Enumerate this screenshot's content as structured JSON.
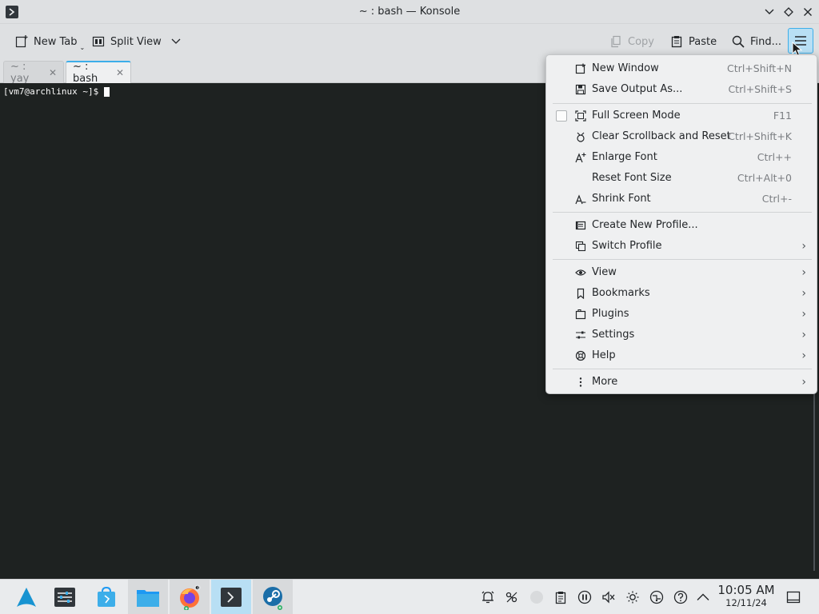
{
  "window": {
    "title": "~ : bash — Konsole"
  },
  "toolbar": {
    "new_tab": "New Tab",
    "split_view": "Split View",
    "copy": "Copy",
    "paste": "Paste",
    "find": "Find..."
  },
  "tabs": [
    {
      "label": "~ : yay"
    },
    {
      "label": "~ : bash"
    }
  ],
  "terminal": {
    "prompt": "[vm7@archlinux ~]$"
  },
  "menu": {
    "items": [
      {
        "label": "New Window",
        "shortcut": "Ctrl+Shift+N",
        "icon": "new-window-icon"
      },
      {
        "label": "Save Output As...",
        "shortcut": "Ctrl+Shift+S",
        "icon": "save-icon"
      },
      {
        "label": "Full Screen Mode",
        "shortcut": "F11",
        "icon": "fullscreen-icon",
        "checked": false
      },
      {
        "label": "Clear Scrollback and Reset",
        "shortcut": "Ctrl+Shift+K",
        "icon": "clear-icon"
      },
      {
        "label": "Enlarge Font",
        "shortcut": "Ctrl++",
        "icon": "font-enlarge-icon"
      },
      {
        "label": "Reset Font Size",
        "shortcut": "Ctrl+Alt+0",
        "icon": ""
      },
      {
        "label": "Shrink Font",
        "shortcut": "Ctrl+-",
        "icon": "font-shrink-icon"
      },
      {
        "label": "Create New Profile...",
        "shortcut": "",
        "icon": "profile-new-icon"
      },
      {
        "label": "Switch Profile",
        "shortcut": "",
        "icon": "switch-profile-icon",
        "submenu": true
      },
      {
        "label": "View",
        "shortcut": "",
        "icon": "eye-icon",
        "submenu": true
      },
      {
        "label": "Bookmarks",
        "shortcut": "",
        "icon": "bookmark-icon",
        "submenu": true
      },
      {
        "label": "Plugins",
        "shortcut": "",
        "icon": "plugin-icon",
        "submenu": true
      },
      {
        "label": "Settings",
        "shortcut": "",
        "icon": "settings-icon",
        "submenu": true
      },
      {
        "label": "Help",
        "shortcut": "",
        "icon": "help-icon",
        "submenu": true
      },
      {
        "label": "More",
        "shortcut": "",
        "icon": "more-icon",
        "submenu": true
      }
    ]
  },
  "taskbar": {
    "clock_time": "10:05 AM",
    "clock_date": "12/11/24"
  },
  "colors": {
    "accent": "#3daee9",
    "terminal_bg": "#1e2221",
    "chrome_bg": "#dee0e2",
    "menu_bg": "#eff0f1"
  }
}
